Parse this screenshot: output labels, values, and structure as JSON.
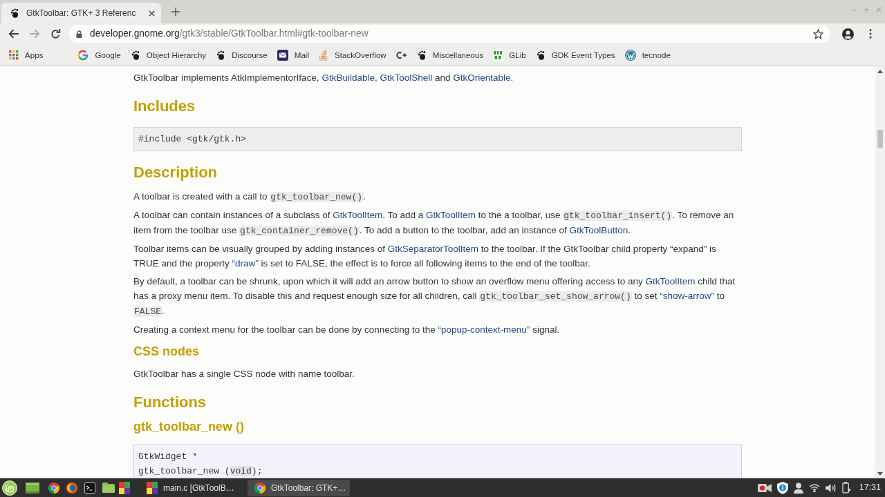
{
  "browser": {
    "tabs": [
      {
        "title": "GtkToolbar: GTK+ 3 Referenc",
        "selected": true
      }
    ],
    "nav": [
      {
        "kind": "back",
        "disabled": false
      },
      {
        "kind": "forward",
        "disabled": true
      },
      {
        "kind": "reload",
        "disabled": false
      }
    ],
    "address": {
      "host": "developer.gnome.org",
      "path": "/gtk3/stable/GtkToolbar.html#gtk-toolbar-new"
    },
    "bookmarks": [
      {
        "kind": "grid",
        "label": "Apps"
      },
      {
        "kind": "google",
        "label": "Google"
      },
      {
        "kind": "foot",
        "label": "Object Hierarchy"
      },
      {
        "kind": "foot",
        "label": "Discourse"
      },
      {
        "kind": "mail",
        "label": "Mail"
      },
      {
        "kind": "stack",
        "label": "StackOverflow"
      },
      {
        "kind": "cplus"
      },
      {
        "kind": "foot",
        "label": "Miscellaneous"
      },
      {
        "kind": "fresh",
        "label": "GLib"
      },
      {
        "kind": "foot",
        "label": "GDK Event Types"
      },
      {
        "kind": "wordpress",
        "label": "tecnode"
      }
    ]
  },
  "page": {
    "blocks": [
      {
        "kind": "paragraph",
        "segments": [
          {
            "kind": "text",
            "text": "GtkToolbar implements AtkImplementorIface, "
          },
          {
            "kind": "link",
            "text": "GtkBuildable"
          },
          {
            "kind": "text",
            "text": ", "
          },
          {
            "kind": "link",
            "text": "GtkToolShell"
          },
          {
            "kind": "text",
            "text": " and "
          },
          {
            "kind": "link",
            "text": "GtkOrientable"
          },
          {
            "kind": "text",
            "text": "."
          }
        ]
      },
      {
        "kind": "heading",
        "text": "Includes"
      },
      {
        "kind": "code",
        "lines": [
          [
            {
              "kind": "text",
              "text": "#include <gtk/gtk.h>"
            }
          ]
        ]
      },
      {
        "kind": "heading",
        "text": "Description"
      },
      {
        "kind": "paragraph",
        "segments": [
          {
            "kind": "text",
            "text": "A toolbar is created with a call to "
          },
          {
            "kind": "code",
            "text": "gtk_toolbar_new()"
          },
          {
            "kind": "text",
            "text": "."
          }
        ]
      },
      {
        "kind": "paragraph",
        "segments": [
          {
            "kind": "text",
            "text": "A toolbar can contain instances of a subclass of "
          },
          {
            "kind": "link",
            "text": "GtkToolItem"
          },
          {
            "kind": "text",
            "text": ". To add a "
          },
          {
            "kind": "link",
            "text": "GtkToolItem"
          },
          {
            "kind": "text",
            "text": " to the a toolbar, use "
          },
          {
            "kind": "code",
            "text": "gtk_toolbar_insert()"
          },
          {
            "kind": "text",
            "text": ". To remove an item from the toolbar use "
          },
          {
            "kind": "code",
            "text": "gtk_container_remove()"
          },
          {
            "kind": "text",
            "text": ". To add a button to the toolbar, add an instance of "
          },
          {
            "kind": "link",
            "text": "GtkToolButton"
          },
          {
            "kind": "text",
            "text": "."
          }
        ]
      },
      {
        "kind": "paragraph",
        "segments": [
          {
            "kind": "text",
            "text": "Toolbar items can be visually grouped by adding instances of "
          },
          {
            "kind": "link",
            "text": "GtkSeparatorToolItem"
          },
          {
            "kind": "text",
            "text": " to the toolbar. If the GtkToolbar child property “expand” is TRUE and the property "
          },
          {
            "kind": "link",
            "text": "“draw”"
          },
          {
            "kind": "text",
            "text": " is set to FALSE, the effect is to force all following items to the end of the toolbar."
          }
        ]
      },
      {
        "kind": "paragraph",
        "segments": [
          {
            "kind": "text",
            "text": "By default, a toolbar can be shrunk, upon which it will add an arrow button to show an overflow menu offering access to any "
          },
          {
            "kind": "link",
            "text": "GtkToolItem"
          },
          {
            "kind": "text",
            "text": " child that has a proxy menu item. To disable this and request enough size for all children, call "
          },
          {
            "kind": "code",
            "text": "gtk_toolbar_set_show_arrow()"
          },
          {
            "kind": "text",
            "text": " to set "
          },
          {
            "kind": "link",
            "text": "“show-arrow”"
          },
          {
            "kind": "text",
            "text": " to "
          },
          {
            "kind": "code",
            "text": "FALSE"
          },
          {
            "kind": "text",
            "text": "."
          }
        ]
      },
      {
        "kind": "paragraph",
        "segments": [
          {
            "kind": "text",
            "text": "Creating a context menu for the toolbar can be done by connecting to the "
          },
          {
            "kind": "link",
            "text": "“popup-context-menu”"
          },
          {
            "kind": "text",
            "text": " signal."
          }
        ]
      },
      {
        "kind": "subheading",
        "text": "CSS nodes"
      },
      {
        "kind": "paragraph",
        "segments": [
          {
            "kind": "text",
            "text": "GtkToolbar has a single CSS node with name toolbar."
          }
        ]
      },
      {
        "kind": "heading",
        "text": "Functions"
      },
      {
        "kind": "subheading",
        "text": "gtk_toolbar_new ()"
      },
      {
        "kind": "function_code",
        "lines": [
          [
            {
              "kind": "text",
              "text": "GtkWidget *"
            }
          ],
          [
            {
              "kind": "text",
              "text": "gtk_toolbar_new ("
            },
            {
              "kind": "type",
              "text": "void"
            },
            {
              "kind": "text",
              "text": ");"
            }
          ]
        ]
      }
    ]
  },
  "taskbar": {
    "windows": [
      {
        "kind": "app",
        "title": "main.c [GtkToolB…",
        "selected": false
      },
      {
        "kind": "chrome",
        "title": "GtkToolbar: GTK+…",
        "selected": true
      }
    ],
    "clock": "17:31"
  }
}
